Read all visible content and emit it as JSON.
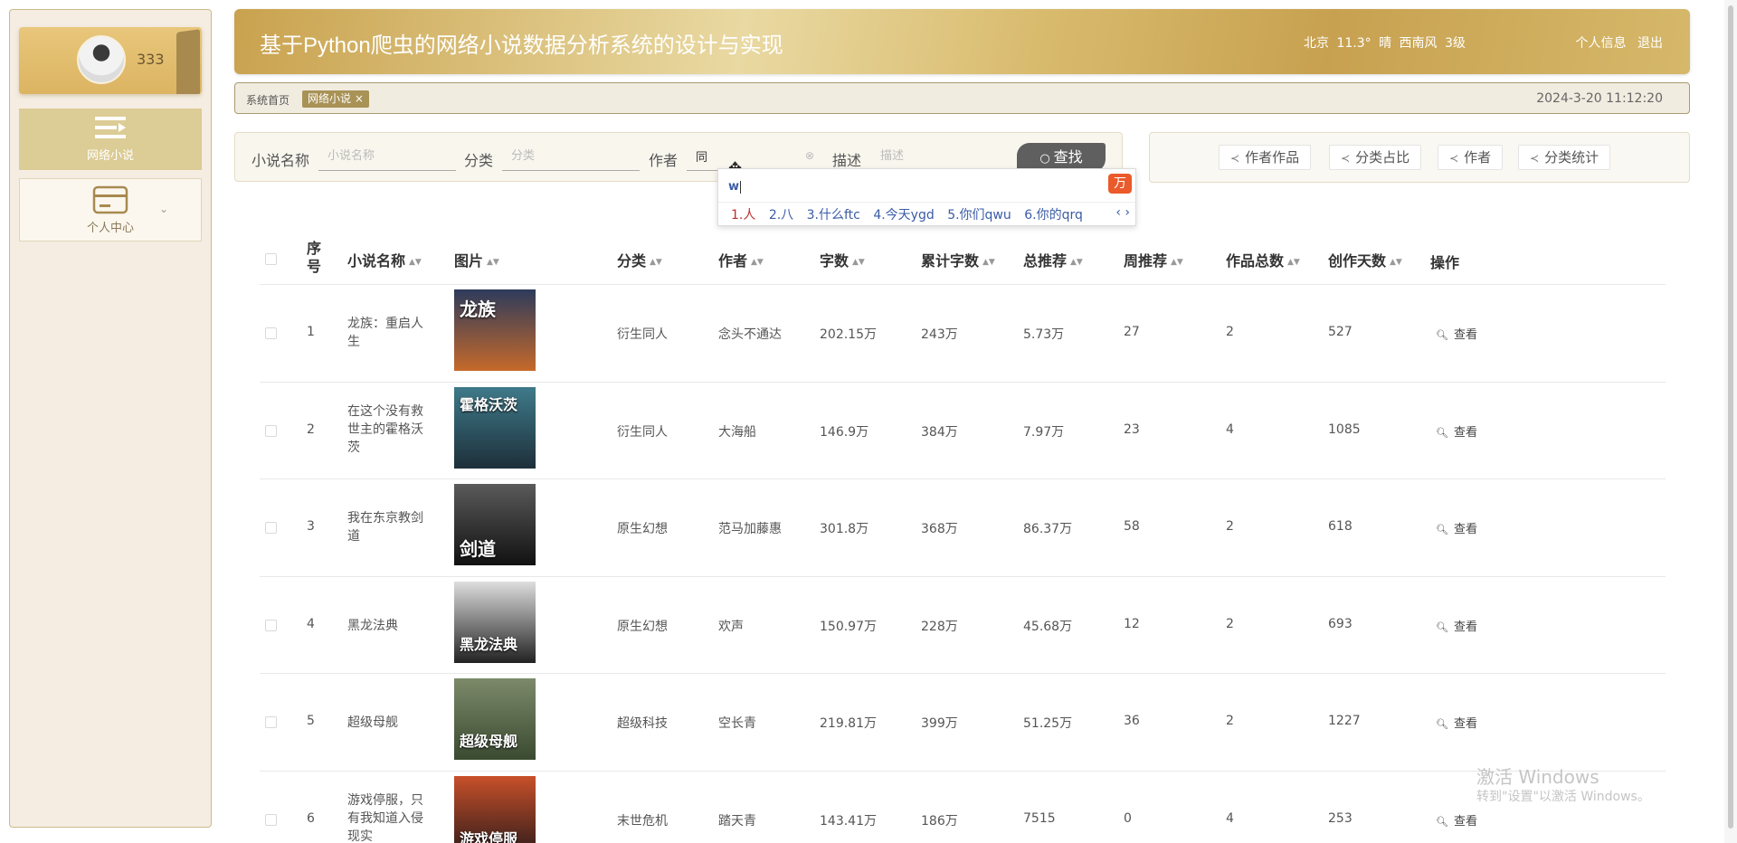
{
  "sidebar": {
    "user_name": "333",
    "items": [
      {
        "label": "网络小说",
        "icon": "list-icon",
        "active": true
      },
      {
        "label": "个人中心",
        "icon": "card-icon",
        "active": false
      }
    ]
  },
  "header": {
    "title": "基于Python爬虫的网络小说数据分析系统的设计与实现",
    "weather": "北京 11.3° 晴 西南风 3级",
    "profile_link": "个人信息",
    "logout_link": "退出"
  },
  "tabbar": {
    "home": "系统首页",
    "active_tab": "网络小说 ×",
    "datetime": "2024-3-20 11:12:20"
  },
  "search": {
    "name_label": "小说名称",
    "name_placeholder": "小说名称",
    "category_label": "分类",
    "category_placeholder": "分类",
    "author_label": "作者",
    "author_value": "同",
    "desc_label": "描述",
    "desc_placeholder": "描述",
    "search_button": "查找"
  },
  "chart_buttons": [
    "作者作品",
    "分类占比",
    "作者",
    "分类统计"
  ],
  "ime": {
    "composition": "w",
    "candidates": [
      "1.人",
      "2.八",
      "3.什么ftc",
      "4.今天ygd",
      "5.你们qwu",
      "6.你的qrq"
    ],
    "arrows": "‹ ›"
  },
  "table": {
    "columns": [
      "序号",
      "小说名称",
      "图片",
      "分类",
      "作者",
      "字数",
      "累计字数",
      "总推荐",
      "周推荐",
      "作品总数",
      "创作天数",
      "操作"
    ],
    "view_label": "查看",
    "rows": [
      {
        "index": "1",
        "name": "龙族：重启人生",
        "cover_text": "龙族",
        "cover_colors": [
          "#2d3b5c",
          "#c6692a"
        ],
        "category": "衍生同人",
        "author": "念头不通达",
        "words": "202.15万",
        "total_words": "243万",
        "total_rec": "5.73万",
        "week_rec": "27",
        "works": "2",
        "days": "527"
      },
      {
        "index": "2",
        "name": "在这个没有救世主的霍格沃茨",
        "cover_text": "霍格沃茨",
        "cover_colors": [
          "#3f7a8a",
          "#1d2f3a"
        ],
        "category": "衍生同人",
        "author": "大海船",
        "words": "146.9万",
        "total_words": "384万",
        "total_rec": "7.97万",
        "week_rec": "23",
        "works": "4",
        "days": "1085"
      },
      {
        "index": "3",
        "name": "我在东京教剑道",
        "cover_text": "剑道",
        "cover_colors": [
          "#5a5a5a",
          "#111111"
        ],
        "category": "原生幻想",
        "author": "范马加藤惠",
        "words": "301.8万",
        "total_words": "368万",
        "total_rec": "86.37万",
        "week_rec": "58",
        "works": "2",
        "days": "618"
      },
      {
        "index": "4",
        "name": "黑龙法典",
        "cover_text": "黑龙法典",
        "cover_colors": [
          "#dddddd",
          "#222222"
        ],
        "category": "原生幻想",
        "author": "欢声",
        "words": "150.97万",
        "total_words": "228万",
        "total_rec": "45.68万",
        "week_rec": "12",
        "works": "2",
        "days": "693"
      },
      {
        "index": "5",
        "name": "超级母舰",
        "cover_text": "超级母舰",
        "cover_colors": [
          "#7c8a6a",
          "#3a4a30"
        ],
        "category": "超级科技",
        "author": "空长青",
        "words": "219.81万",
        "total_words": "399万",
        "total_rec": "51.25万",
        "week_rec": "36",
        "works": "2",
        "days": "1227"
      },
      {
        "index": "6",
        "name": "游戏停服，只有我知道入侵现实",
        "cover_text": "游戏停服",
        "cover_colors": [
          "#c8502a",
          "#2a1a1a"
        ],
        "category": "末世危机",
        "author": "踏天青",
        "words": "143.41万",
        "total_words": "186万",
        "total_rec": "7515",
        "week_rec": "0",
        "works": "4",
        "days": "253"
      }
    ]
  },
  "watermark": {
    "line1": "激活 Windows",
    "line2": "转到\"设置\"以激活 Windows。"
  },
  "colors": {
    "accent": "#c9a24e",
    "sidebar_active": "#dccc95",
    "tab_active": "#a89256",
    "search_button": "#5f5f5f"
  }
}
